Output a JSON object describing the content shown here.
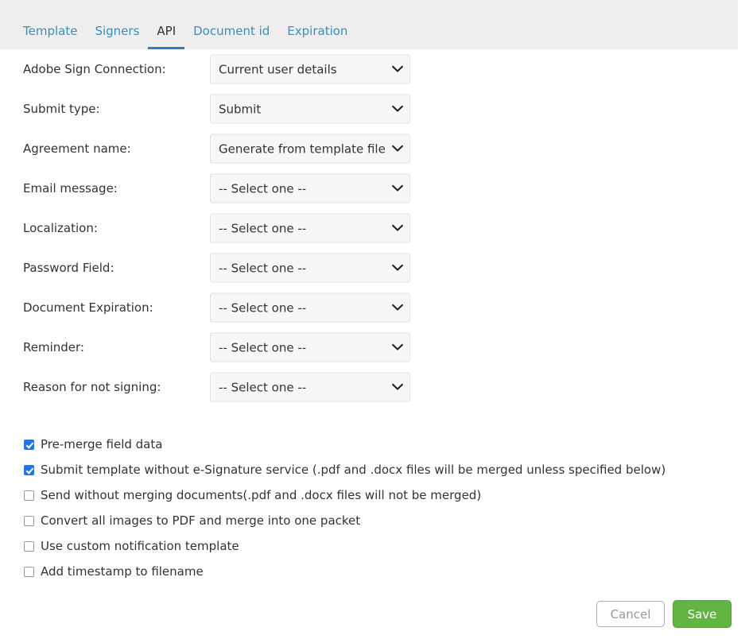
{
  "tabs": [
    {
      "label": "Template",
      "active": false
    },
    {
      "label": "Signers",
      "active": false
    },
    {
      "label": "API",
      "active": true
    },
    {
      "label": "Document id",
      "active": false
    },
    {
      "label": "Expiration",
      "active": false
    }
  ],
  "form": {
    "rows": [
      {
        "label": "Adobe Sign Connection:",
        "value": "Current user details"
      },
      {
        "label": "Submit type:",
        "value": "Submit"
      },
      {
        "label": "Agreement name:",
        "value": "Generate from template file"
      },
      {
        "label": "Email message:",
        "value": "-- Select one --"
      },
      {
        "label": "Localization:",
        "value": "-- Select one --"
      },
      {
        "label": "Password Field:",
        "value": "-- Select one --"
      },
      {
        "label": "Document Expiration:",
        "value": "-- Select one --"
      },
      {
        "label": "Reminder:",
        "value": "-- Select one --"
      },
      {
        "label": "Reason for not signing:",
        "value": "-- Select one --"
      }
    ]
  },
  "checkboxes": [
    {
      "label": "Pre-merge field data",
      "checked": true
    },
    {
      "label": "Submit template without e-Signature service (.pdf and .docx files will be merged unless specified below)",
      "checked": true
    },
    {
      "label": "Send without merging documents(.pdf and .docx files will not be merged)",
      "checked": false
    },
    {
      "label": "Convert all images to PDF and merge into one packet",
      "checked": false
    },
    {
      "label": "Use custom notification template",
      "checked": false
    },
    {
      "label": "Add timestamp to filename",
      "checked": false
    }
  ],
  "footer": {
    "cancel_label": "Cancel",
    "save_label": "Save"
  },
  "colors": {
    "tab_link": "#3c8dbc",
    "tab_active_underline": "#2f7fc1",
    "header_bg": "#eeeeee",
    "checkbox_checked": "#2176e0",
    "save_bg": "#62b543",
    "cancel_border": "#adadad"
  },
  "icons": {
    "chevron": "chevron-down-icon"
  }
}
